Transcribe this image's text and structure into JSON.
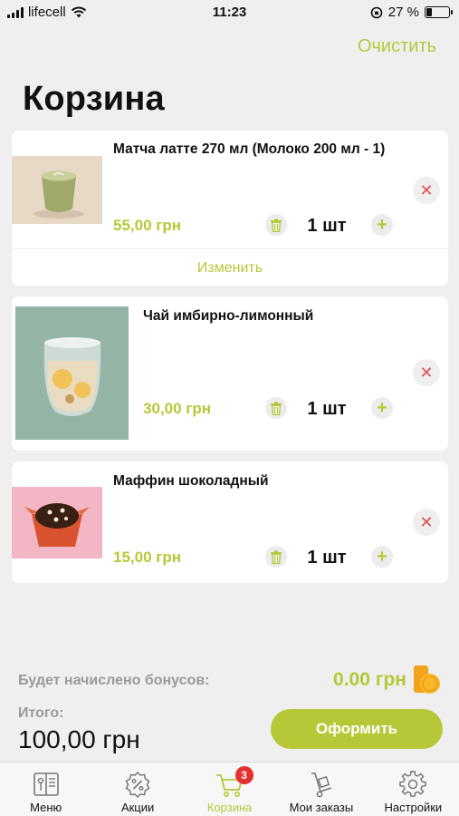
{
  "status": {
    "carrier": "lifecell",
    "time": "11:23",
    "battery_percent": "27 %",
    "battery_level": 0.27
  },
  "header": {
    "clear_label": "Очистить",
    "title": "Корзина"
  },
  "cart_items": [
    {
      "name": "Матча латте 270 мл (Молоко 200 мл - 1)",
      "price": "55,00 грн",
      "quantity": "1 шт",
      "edit_label": "Изменить",
      "image": "matcha-latte-cup"
    },
    {
      "name": "Чай имбирно-лимонный",
      "price": "30,00 грн",
      "quantity": "1 шт",
      "image": "ginger-lemon-tea-glass"
    },
    {
      "name": "Маффин шоколадный",
      "price": "15,00 грн",
      "quantity": "1 шт",
      "image": "chocolate-muffin"
    }
  ],
  "summary": {
    "bonus_label": "Будет начислено бонусов:",
    "bonus_value": "0.00 грн",
    "total_label": "Итого:",
    "total_value": "100,00 грн",
    "checkout_label": "Оформить"
  },
  "tabbar": {
    "tabs": [
      {
        "label": "Меню",
        "icon": "menu-book-icon"
      },
      {
        "label": "Акции",
        "icon": "discount-badge-icon"
      },
      {
        "label": "Корзина",
        "icon": "cart-icon",
        "badge": "3",
        "active": true
      },
      {
        "label": "Мои заказы",
        "icon": "hand-truck-icon"
      },
      {
        "label": "Настройки",
        "icon": "gear-icon"
      }
    ]
  },
  "colors": {
    "accent": "#b6c838",
    "remove": "#e05050",
    "badge": "#e53030",
    "background": "#efefef"
  }
}
